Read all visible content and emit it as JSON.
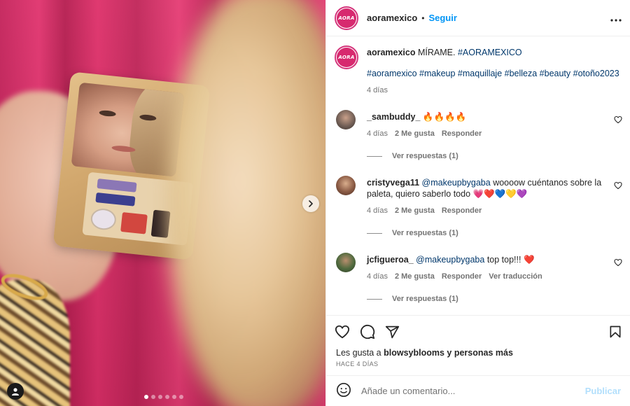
{
  "post": {
    "username": "aoramexico",
    "separator": "•",
    "follow_label": "Seguir",
    "more_label": "•••",
    "logo_text": "AORA"
  },
  "caption": {
    "username": "aoramexico",
    "text": "MÍRAME.",
    "hashtag_main": "#AORAMEXICO",
    "hashtags": "#aoramexico #makeup #maquillaje #belleza #beauty #otoño2023",
    "time": "4 días"
  },
  "comments": [
    {
      "username": "_sambuddy_",
      "mention": "",
      "text": "🔥🔥🔥🔥",
      "time": "4 días",
      "likes": "2 Me gusta",
      "reply": "Responder",
      "translate": "",
      "view_replies": "Ver respuestas (1)",
      "avatar_color": "#6b5a52"
    },
    {
      "username": "cristyvega11",
      "mention": "@makeupbygaba",
      "text": "woooow cuéntanos sobre la paleta, quiero saberlo todo 💗❤️💙💛💜",
      "time": "4 días",
      "likes": "2 Me gusta",
      "reply": "Responder",
      "translate": "",
      "view_replies": "Ver respuestas (1)",
      "avatar_color": "#8a5a44"
    },
    {
      "username": "jcfigueroa_",
      "mention": "@makeupbygaba",
      "text": "top top!!! ❤️",
      "time": "4 días",
      "likes": "2 Me gusta",
      "reply": "Responder",
      "translate": "Ver traducción",
      "view_replies": "Ver respuestas (1)",
      "avatar_color": "#4f6a3e"
    }
  ],
  "likes": {
    "prefix": "Les gusta a ",
    "user": "blowsyblooms",
    "suffix": " y personas más"
  },
  "date": "HACE 4 DÍAS",
  "add_comment": {
    "placeholder": "Añade un comentario...",
    "publish_label": "Publicar"
  },
  "carousel": {
    "slide_count": 6,
    "active_index": 0
  },
  "icons": {
    "like": "heart-icon",
    "comment": "comment-icon",
    "share": "send-icon",
    "save": "bookmark-icon",
    "emoji": "emoji-icon",
    "next": "chevron-right-icon",
    "tag": "user-tag-icon"
  },
  "colors": {
    "accent": "#0095f6",
    "brand": "#d72a6f",
    "link": "#00376b",
    "muted": "#737373",
    "publish_disabled": "#b2dffc"
  }
}
